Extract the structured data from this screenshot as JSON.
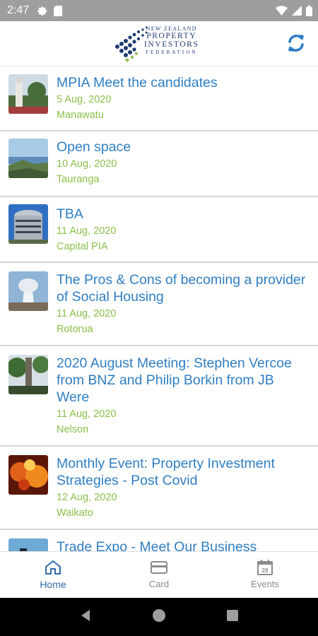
{
  "status_bar": {
    "time": "2:47",
    "left_icons": [
      "gear-icon",
      "sd-card-icon"
    ],
    "right_icons": [
      "wifi-icon",
      "signal-icon",
      "battery-icon"
    ]
  },
  "header": {
    "logo": {
      "line1": "NEW ZEALAND",
      "line2": "PROPERTY",
      "line3": "INVESTORS",
      "line4": "FEDERATION"
    },
    "refresh_icon": "refresh-icon"
  },
  "events": [
    {
      "title": "MPIA Meet the candidates",
      "date": "5 Aug, 2020",
      "location": "Manawatu"
    },
    {
      "title": "Open space",
      "date": "10 Aug, 2020",
      "location": "Tauranga"
    },
    {
      "title": "TBA",
      "date": "11 Aug, 2020",
      "location": "Capital PIA"
    },
    {
      "title": "The Pros & Cons of becoming a provider of Social Housing",
      "date": "11 Aug, 2020",
      "location": "Rotorua"
    },
    {
      "title": "2020 August Meeting: Stephen Vercoe from BNZ and Philip Borkin from JB Were",
      "date": "11 Aug, 2020",
      "location": "Nelson"
    },
    {
      "title": "Monthly Event: Property Investment Strategies - Post Covid",
      "date": "12 Aug, 2020",
      "location": "Waikato"
    },
    {
      "title": "Trade Expo - Meet Our Business",
      "date": "",
      "location": ""
    }
  ],
  "tabs": [
    {
      "label": "Home",
      "icon": "home-icon",
      "active": true
    },
    {
      "label": "Card",
      "icon": "card-icon",
      "active": false
    },
    {
      "label": "Events",
      "icon": "calendar-icon",
      "active": false
    }
  ],
  "nav_bar": [
    "back-icon",
    "home-circle-icon",
    "recents-icon"
  ],
  "colors": {
    "title_blue": "#2f7ec3",
    "meta_green": "#8bc04a",
    "active_tab": "#2f6aa8",
    "status_bar": "#9e9e9e"
  }
}
